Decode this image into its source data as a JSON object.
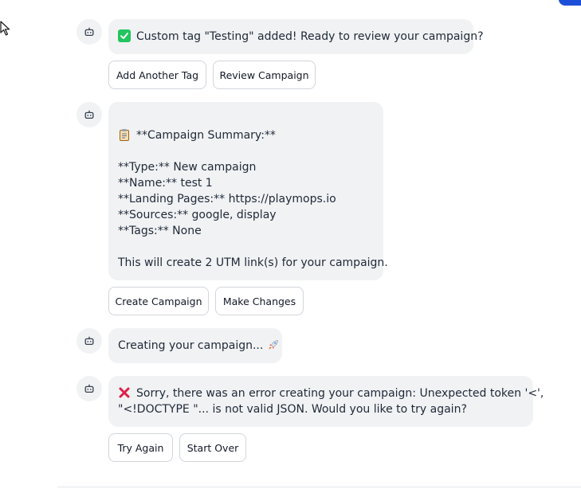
{
  "messages": [
    {
      "icon": "check-mark-icon",
      "lines": [
        "Custom tag \"Testing\" added! Ready to review your campaign?"
      ],
      "actions": [
        "Add Another Tag",
        "Review Campaign"
      ]
    },
    {
      "icon": "clipboard-icon",
      "lines": [
        "",
        "**Campaign Summary:**",
        "",
        "**Type:** New campaign",
        "**Name:** test 1",
        "**Landing Pages:** https://playmops.io",
        "**Sources:** google, display",
        "**Tags:** None",
        "",
        "This will create 2 UTM link(s) for your campaign."
      ],
      "actions": [
        "Create Campaign",
        "Make Changes"
      ]
    },
    {
      "icon": "rocket-icon",
      "lines": [
        "Creating your campaign... "
      ],
      "actions": []
    },
    {
      "icon": "cross-mark-icon",
      "lines": [
        "Sorry, there was an error creating your campaign: Unexpected token '<',",
        "\"<!DOCTYPE \"... is not valid JSON. Would you like to try again?"
      ],
      "actions": [
        "Try Again",
        "Start Over"
      ]
    }
  ],
  "colors": {
    "bubble_bg": "#f1f2f4",
    "accent": "#1d4ed8",
    "check": "#22c55e",
    "error": "#e11d48"
  }
}
